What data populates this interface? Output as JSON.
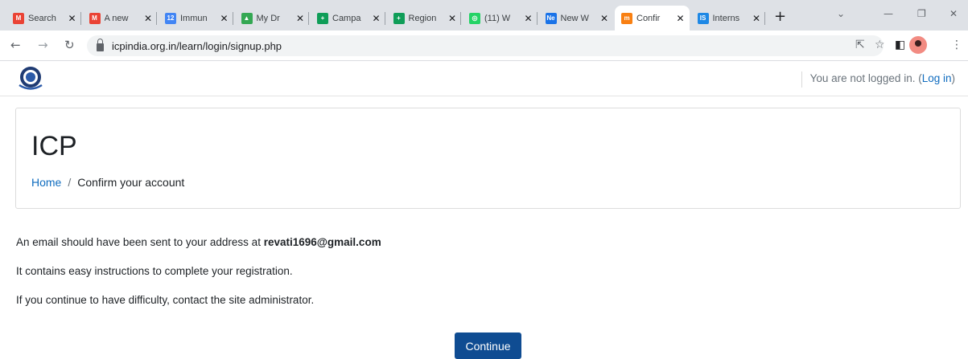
{
  "browser": {
    "tabs": [
      {
        "title": "Search",
        "icon": "gmail-icon",
        "color": "#ea4335",
        "fav": "M"
      },
      {
        "title": "A new",
        "icon": "gmail-icon",
        "color": "#ea4335",
        "fav": "M"
      },
      {
        "title": "Immun",
        "icon": "calendar-icon",
        "color": "#4285f4",
        "fav": "12"
      },
      {
        "title": "My Dr",
        "icon": "drive-icon",
        "color": "#34a853",
        "fav": "▲"
      },
      {
        "title": "Campa",
        "icon": "sheets-icon",
        "color": "#0f9d58",
        "fav": "+"
      },
      {
        "title": "Region",
        "icon": "sheets-icon",
        "color": "#0f9d58",
        "fav": "+"
      },
      {
        "title": "(11) W",
        "icon": "whatsapp-icon",
        "color": "#25d366",
        "fav": "◎"
      },
      {
        "title": "New W",
        "icon": "ne-icon",
        "color": "#1a73e8",
        "fav": "Ne"
      },
      {
        "title": "Confir",
        "icon": "moodle-icon",
        "color": "#f98012",
        "fav": "m"
      },
      {
        "title": "Interns",
        "icon": "is-icon",
        "color": "#1e88e5",
        "fav": "IS"
      }
    ],
    "active_tab_index": 8,
    "new_tab_label": "+",
    "url": "icpindia.org.in/learn/login/signup.php"
  },
  "navbar": {
    "login_status": "You are not logged in. (",
    "login_link": "Log in",
    "login_close": ")"
  },
  "header": {
    "site_title": "ICP",
    "breadcrumb": {
      "home": "Home",
      "separator": "/",
      "current": "Confirm your account"
    }
  },
  "main": {
    "line1_prefix": "An email should have been sent to your address at ",
    "email": "revati1696@gmail.com",
    "line2": "It contains easy instructions to complete your registration.",
    "line3": "If you continue to have difficulty, contact the site administrator.",
    "continue_label": "Continue"
  },
  "colors": {
    "link": "#0f6cbf",
    "primary_button": "#0f4c92"
  }
}
